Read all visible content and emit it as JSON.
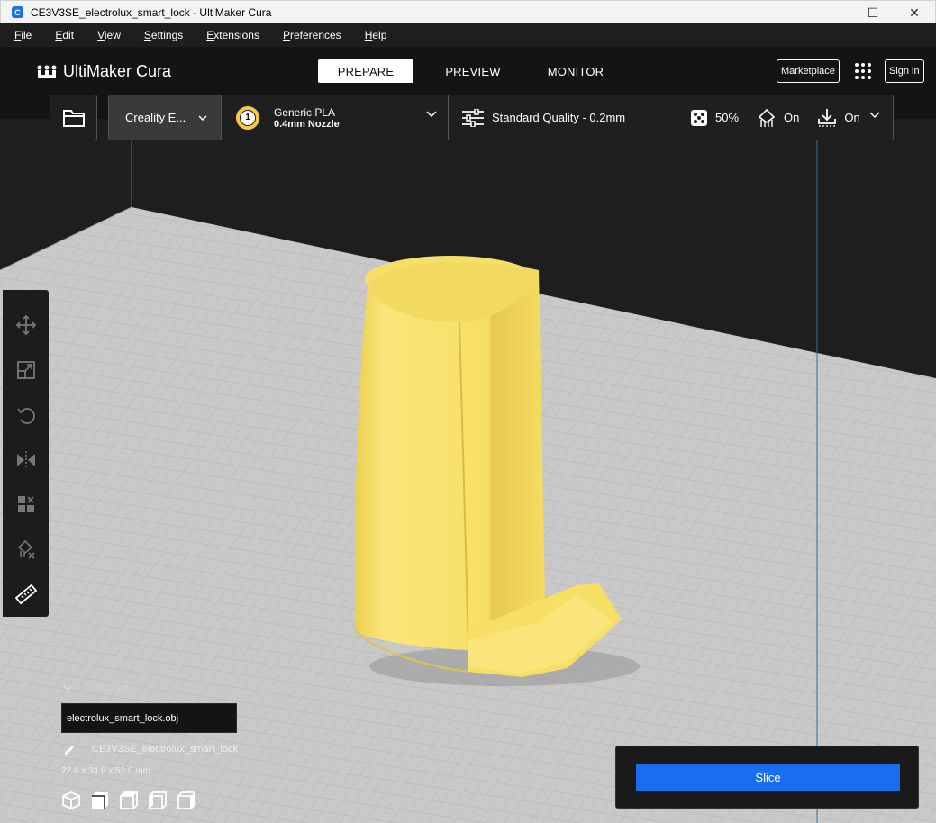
{
  "window": {
    "title": "CE3V3SE_electrolux_smart_lock - UltiMaker Cura",
    "app_icon_letter": "C",
    "controls": [
      "—",
      "☐",
      "✕"
    ]
  },
  "menu": [
    {
      "u": "F",
      "rest": "ile"
    },
    {
      "u": "E",
      "rest": "dit"
    },
    {
      "u": "V",
      "rest": "iew"
    },
    {
      "u": "S",
      "rest": "ettings"
    },
    {
      "u": "E",
      "rest": "xtensions"
    },
    {
      "u": "P",
      "rest": "references"
    },
    {
      "u": "H",
      "rest": "elp"
    }
  ],
  "header": {
    "logo_text": "UltiMaker Cura",
    "tabs": [
      "PREPARE",
      "PREVIEW",
      "MONITOR"
    ],
    "active_tab": "PREPARE",
    "marketplace": "Marketplace",
    "sign_in": "Sign in"
  },
  "stage": {
    "printer": "Creality E...",
    "extruder_number": "1",
    "material": "Generic PLA",
    "nozzle": "0.4mm Nozzle",
    "quality": "Standard Quality - 0.2mm",
    "infill": "50%",
    "support": "On",
    "adhesion": "On"
  },
  "tools": [
    "move-tool",
    "scale-tool",
    "rotate-tool",
    "mirror-tool",
    "per-model-settings-tool",
    "support-blocker-tool",
    "measure-tool"
  ],
  "object_list": {
    "toggle_label": "Object list",
    "file": "electrolux_smart_lock.obj",
    "job_name": "CE3V3SE_electrolux_smart_lock",
    "dimensions": "22.6 x 34.8 x 52.0 mm"
  },
  "slice": {
    "label": "Slice"
  },
  "colors": {
    "accent": "#196ef0",
    "model": "#f7e06a",
    "extruder": "#f7c948",
    "build_plate": "#c8c8c8"
  }
}
